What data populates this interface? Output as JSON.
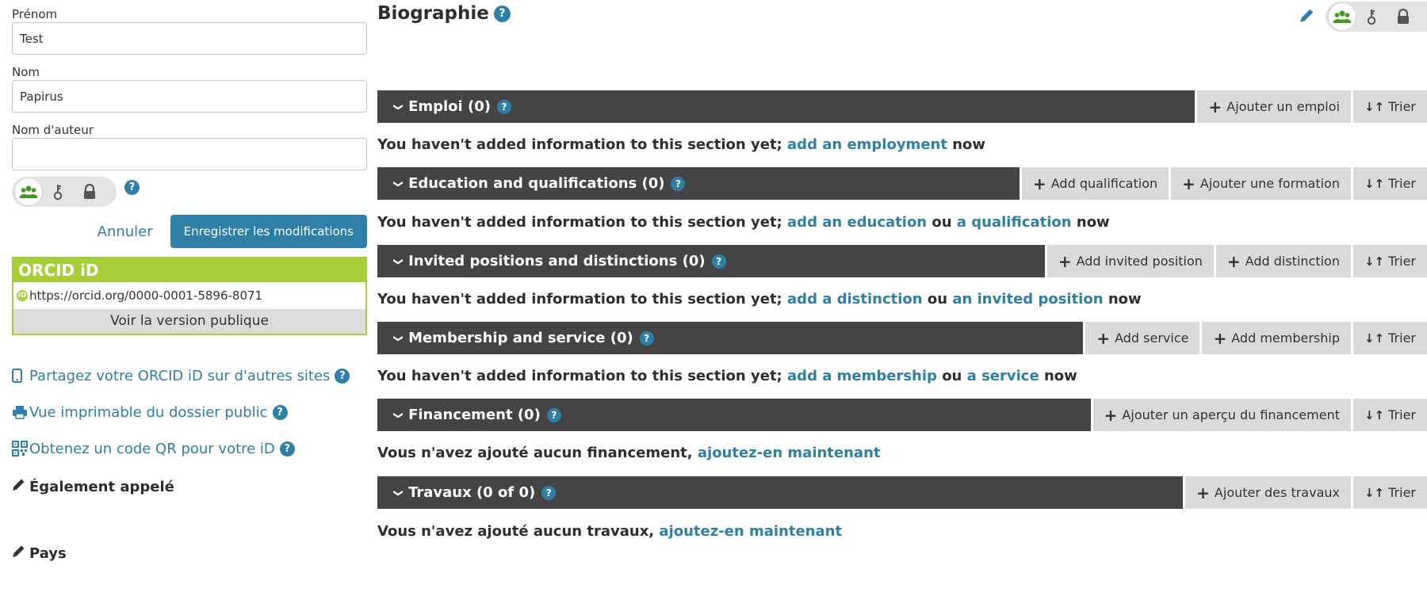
{
  "form": {
    "first_name_label": "Prénom",
    "first_name_value": "Test",
    "last_name_label": "Nom",
    "last_name_value": "Papirus",
    "author_name_label": "Nom d'auteur",
    "author_name_value": "",
    "cancel_label": "Annuler",
    "save_label": "Enregistrer les modifications"
  },
  "orcid": {
    "title": "ORCID iD",
    "url": "https://orcid.org/0000-0001-5896-8071",
    "public_version": "Voir la version publique"
  },
  "side_links": [
    {
      "label": "Partagez votre ORCID iD sur d'autres sites",
      "icon": "mobile-icon"
    },
    {
      "label": "Vue imprimable du dossier public",
      "icon": "printer-icon"
    },
    {
      "label": "Obtenez un code QR pour votre iD",
      "icon": "qr-code-icon"
    }
  ],
  "also_known": "Également appelé",
  "country": "Pays",
  "bio": {
    "title": "Biographie"
  },
  "sections": [
    {
      "title": "Emploi (0)",
      "buttons": [
        "Ajouter un emploi"
      ],
      "sort": "Trier",
      "empty_prefix": "You haven't added information to this section yet;",
      "link1": "add an employment",
      "mid": "",
      "link2": "",
      "suffix": "now"
    },
    {
      "title": "Education and qualifications (0)",
      "buttons": [
        "Add qualification",
        "Ajouter une formation"
      ],
      "sort": "Trier",
      "empty_prefix": "You haven't added information to this section yet;",
      "link1": "add an education",
      "mid": "ou",
      "link2": "a qualification",
      "suffix": "now"
    },
    {
      "title": "Invited positions and distinctions (0)",
      "buttons": [
        "Add invited position",
        "Add distinction"
      ],
      "sort": "Trier",
      "empty_prefix": "You haven't added information to this section yet;",
      "link1": "add a distinction",
      "mid": "ou",
      "link2": "an invited position",
      "suffix": "now"
    },
    {
      "title": "Membership and service (0)",
      "buttons": [
        "Add service",
        "Add membership"
      ],
      "sort": "Trier",
      "empty_prefix": "You haven't added information to this section yet;",
      "link1": "add a membership",
      "mid": "ou",
      "link2": "a service",
      "suffix": "now"
    },
    {
      "title": "Financement (0)",
      "buttons": [
        "Ajouter un aperçu du financement"
      ],
      "sort": "Trier",
      "empty_prefix": "Vous n'avez ajouté aucun financement,",
      "link1": "ajoutez-en maintenant",
      "mid": "",
      "link2": "",
      "suffix": ""
    },
    {
      "title": "Travaux (0 of 0)",
      "buttons": [
        "Ajouter des travaux"
      ],
      "sort": "Trier",
      "empty_prefix": "Vous n'avez ajouté aucun travaux,",
      "link1": "ajoutez-en maintenant",
      "mid": "",
      "link2": "",
      "suffix": ""
    }
  ],
  "colors": {
    "accent": "#2e7fa7",
    "orcid_green": "#a6ce39",
    "section_bar": "#444446",
    "section_button": "#dadada"
  }
}
